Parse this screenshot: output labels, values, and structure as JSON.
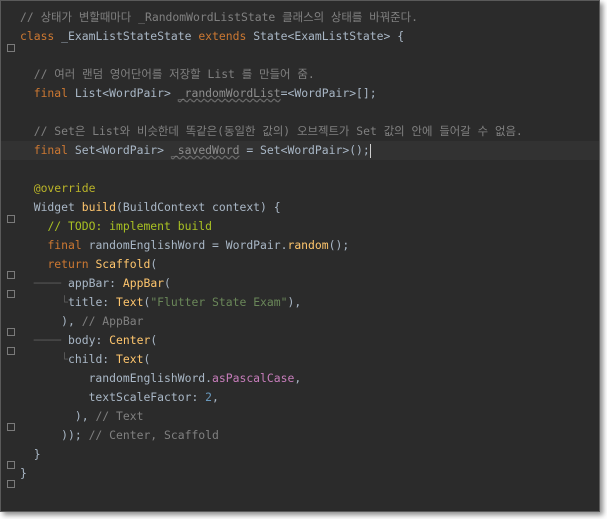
{
  "editor": {
    "lines": [
      {
        "segments": [
          [
            "cm",
            "// 상태가 변할때마다 _RandomWordListState 클래스의 상태를 바꿔준다."
          ]
        ]
      },
      {
        "segments": [
          [
            "kw",
            "class "
          ],
          [
            "",
            "_ExamListStateState "
          ],
          [
            "kw",
            "extends "
          ],
          [
            "",
            "State<ExamListState> {"
          ]
        ]
      },
      {
        "segments": []
      },
      {
        "segments": [
          [
            "",
            "  "
          ],
          [
            "cm",
            "// 여러 랜덤 영어단어를 저장할 List 를 만들어 줌."
          ]
        ]
      },
      {
        "segments": [
          [
            "",
            "  "
          ],
          [
            "kw",
            "final "
          ],
          [
            "",
            "List<WordPair> "
          ],
          [
            "unused",
            "_randomWordList"
          ],
          [
            "",
            "=<WordPair>[];"
          ]
        ]
      },
      {
        "segments": []
      },
      {
        "segments": [
          [
            "",
            "  "
          ],
          [
            "cm",
            "// Set은 List와 비슷한데 똑같은(동일한 값의) 오브젝트가 Set 값의 안에 들어갈 수 없음."
          ]
        ]
      },
      {
        "segments": [
          [
            "",
            "  "
          ],
          [
            "kw",
            "final "
          ],
          [
            "",
            "Set<WordPair> "
          ],
          [
            "unused",
            "_savedWord"
          ],
          [
            "",
            " = Set<WordPair>();"
          ]
        ]
      },
      {
        "segments": []
      },
      {
        "segments": [
          [
            "",
            "  "
          ],
          [
            "ann",
            "@override"
          ]
        ]
      },
      {
        "segments": [
          [
            "",
            "  Widget "
          ],
          [
            "fn",
            "build"
          ],
          [
            "",
            "(BuildContext context) {"
          ]
        ]
      },
      {
        "segments": [
          [
            "",
            "    "
          ],
          [
            "todo",
            "// TODO: implement build"
          ]
        ]
      },
      {
        "segments": [
          [
            "",
            "    "
          ],
          [
            "kw",
            "final "
          ],
          [
            "",
            "randomEnglishWord = WordPair."
          ],
          [
            "fn",
            "random"
          ],
          [
            "",
            "();"
          ]
        ]
      },
      {
        "segments": [
          [
            "",
            "    "
          ],
          [
            "kw",
            "return "
          ],
          [
            "fn",
            "Scaffold"
          ],
          [
            "",
            "("
          ]
        ]
      },
      {
        "segments": [
          [
            "guide",
            "  ──── "
          ],
          [
            "",
            "appBar: "
          ],
          [
            "fn",
            "AppBar"
          ],
          [
            "",
            "("
          ]
        ]
      },
      {
        "segments": [
          [
            "guide",
            "      └"
          ],
          [
            "",
            "title: "
          ],
          [
            "fn",
            "Text"
          ],
          [
            "",
            "("
          ],
          [
            "str",
            "\"Flutter State Exam\""
          ],
          [
            "",
            "),"
          ]
        ]
      },
      {
        "segments": [
          [
            "",
            "      ), "
          ],
          [
            "cm",
            "// AppBar"
          ]
        ]
      },
      {
        "segments": [
          [
            "guide",
            "  ──── "
          ],
          [
            "",
            "body: "
          ],
          [
            "fn",
            "Center"
          ],
          [
            "",
            "("
          ]
        ]
      },
      {
        "segments": [
          [
            "guide",
            "      └"
          ],
          [
            "",
            "child: "
          ],
          [
            "fn",
            "Text"
          ],
          [
            "",
            "("
          ]
        ]
      },
      {
        "segments": [
          [
            "",
            "          randomEnglishWord."
          ],
          [
            "param",
            "asPascalCase"
          ],
          [
            "",
            ","
          ]
        ]
      },
      {
        "segments": [
          [
            "",
            "          textScaleFactor: "
          ],
          [
            "num",
            "2"
          ],
          [
            "",
            ","
          ]
        ]
      },
      {
        "segments": [
          [
            "",
            "        ), "
          ],
          [
            "cm",
            "// Text"
          ]
        ]
      },
      {
        "segments": [
          [
            "",
            "      )); "
          ],
          [
            "cm",
            "// Center, Scaffold"
          ]
        ]
      },
      {
        "segments": [
          [
            "",
            "  }"
          ]
        ]
      },
      {
        "segments": [
          [
            "",
            "}"
          ]
        ]
      }
    ]
  }
}
